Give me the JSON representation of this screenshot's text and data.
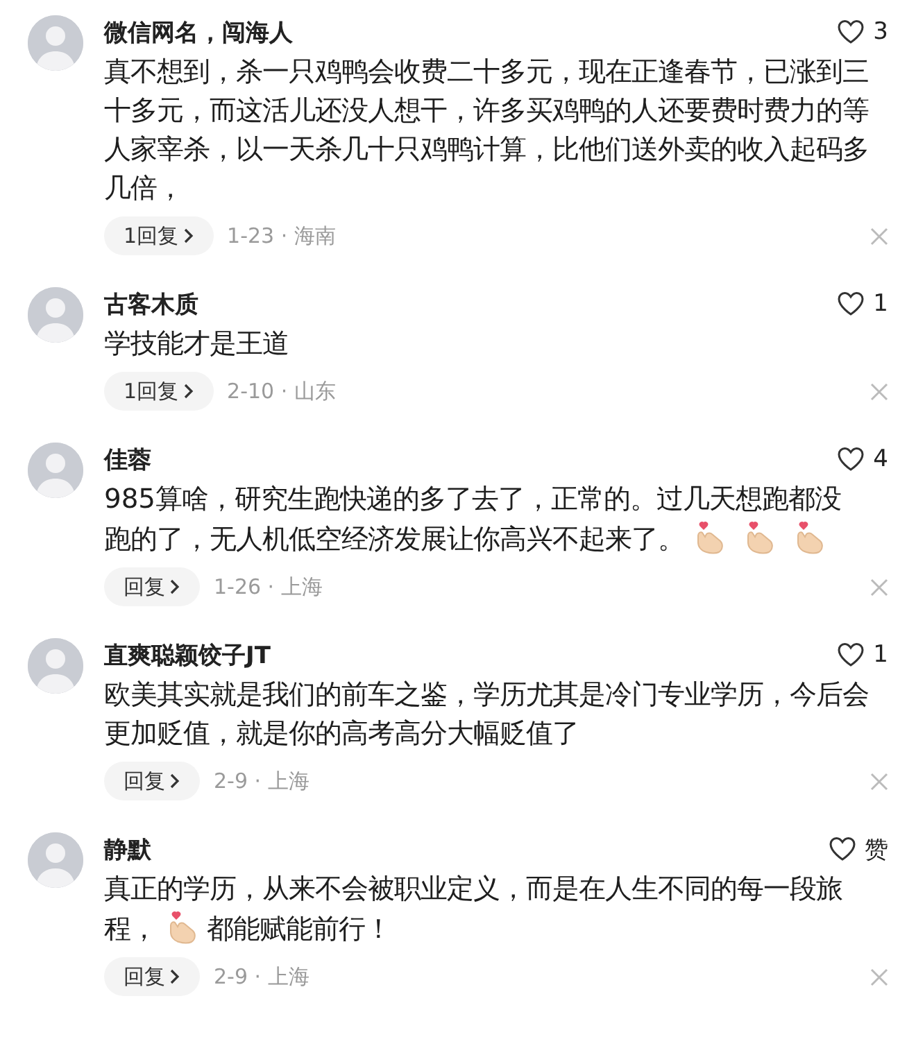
{
  "comments": [
    {
      "name": "微信网名，闯海人",
      "likes": "3",
      "body": [
        {
          "kind": "text",
          "text": "真不想到，杀一只鸡鸭会收费二十多元，现在正逢春节，已涨到三十多元，而这活儿还没人想干，许多买鸡鸭的人还要费时费力的等人家宰杀，以一天杀几十只鸡鸭计算，比他们送外卖的收入起码多几倍，"
        }
      ],
      "reply": "1回复",
      "meta": "1-23 · 海南"
    },
    {
      "name": "古客木质",
      "likes": "1",
      "body": [
        {
          "kind": "text",
          "text": "学技能才是王道"
        }
      ],
      "reply": "1回复",
      "meta": "2-10 · 山东"
    },
    {
      "name": "佳蓉",
      "likes": "4",
      "body": [
        {
          "kind": "text",
          "text": "985算啥，研究生跑快递的多了去了，正常的。过几天想跑都没"
        },
        {
          "kind": "text",
          "text": "跑的了，无人机低空经济发展让你高兴不起来了。"
        },
        {
          "kind": "finger-heart"
        },
        {
          "kind": "finger-heart"
        },
        {
          "kind": "finger-heart"
        }
      ],
      "reply": "回复",
      "meta": "1-26 · 上海"
    },
    {
      "name": "直爽聪颖饺子JT",
      "likes": "1",
      "body": [
        {
          "kind": "text",
          "text": "欧美其实就是我们的前车之鉴，学历尤其是冷门专业学历，今后会更加贬值，就是你的高考高分大幅贬值了"
        }
      ],
      "reply": "回复",
      "meta": "2-9 · 上海"
    },
    {
      "name": "静默",
      "likes": "赞",
      "body": [
        {
          "kind": "text",
          "text": "真正的学历，从来不会被职业定义，而是在人生不同的每一段旅"
        },
        {
          "kind": "text",
          "text": "程，"
        },
        {
          "kind": "finger-heart"
        },
        {
          "kind": "text",
          "text": "都能赋能前行！"
        }
      ],
      "reply": "回复",
      "meta": "2-9 · 上海"
    }
  ]
}
